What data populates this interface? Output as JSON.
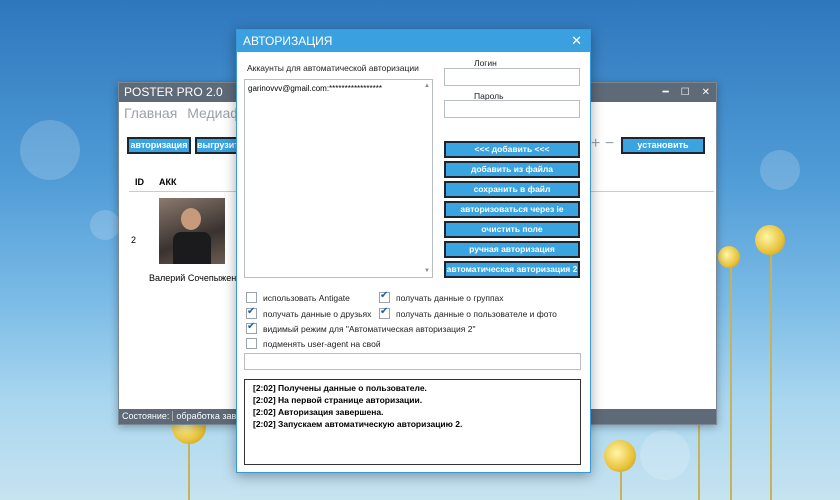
{
  "main_window": {
    "title": "POSTER PRO 2.0",
    "menu": [
      "Главная",
      "Медиафа"
    ],
    "btn_auth": "авторизация",
    "btn_upload": "выгрузит",
    "plus": "+",
    "minus": "−",
    "btn_limit": "установить лимит",
    "columns": [
      "ID",
      "АКК"
    ],
    "row": {
      "id": "2",
      "name": "Валерий Сочепыженко"
    },
    "status": [
      "Состояние:",
      "обработка заверш"
    ]
  },
  "dialog": {
    "title": "АВТОРИЗАЦИЯ",
    "accounts_label": "Аккаунты для автоматической авторизации",
    "account_item": "garinovvv@gmail.com:*****************",
    "login_label": "Логин",
    "password_label": "Пароль",
    "buttons": [
      "<<< добавить <<<",
      "добавить из файла",
      "сохранить в файл",
      "авторизоваться через ie",
      "очистить поле",
      "ручная авторизация",
      "автоматическая авторизация 2"
    ],
    "checkboxes": [
      {
        "label": "использовать Antigate",
        "checked": false
      },
      {
        "label": "получать данные о группах",
        "checked": true
      },
      {
        "label": "получать данные о друзьях",
        "checked": true
      },
      {
        "label": "получать данные о пользователе и фото",
        "checked": true
      },
      {
        "label": "видимый режим для \"Автоматическая авторизация 2\"",
        "checked": true
      },
      {
        "label": "подменять user-agent на свой",
        "checked": false
      }
    ],
    "log": [
      "[2:02]  Получены данные о пользователе.",
      "[2:02]  На первой странице авторизации.",
      "[2:02]  Авторизация завершена.",
      "[2:02]  Запускаем автоматическую авторизацию 2."
    ]
  }
}
